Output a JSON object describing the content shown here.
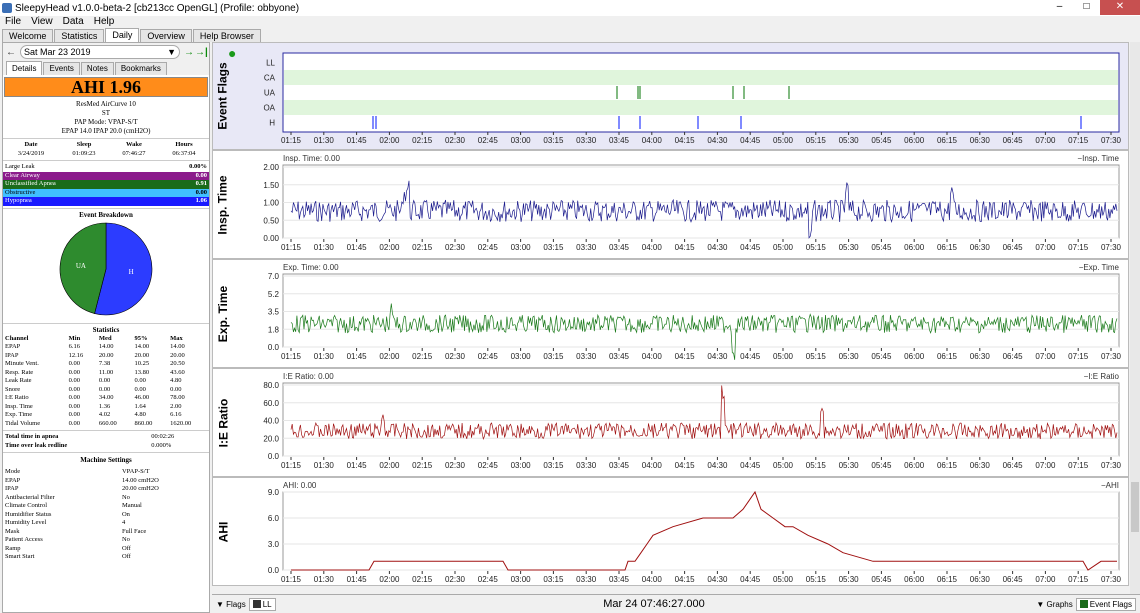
{
  "window": {
    "title": "SleepyHead v1.0.0-beta-2 [cb213cc OpenGL] (Profile: obbyone)"
  },
  "menu": [
    "File",
    "View",
    "Data",
    "Help"
  ],
  "tabs": [
    "Welcome",
    "Statistics",
    "Daily",
    "Overview",
    "Help Browser"
  ],
  "active_tab": "Daily",
  "nav": {
    "date": "Sat Mar 23 2019"
  },
  "subtabs": [
    "Details",
    "Events",
    "Notes",
    "Bookmarks"
  ],
  "summary": {
    "ahi": "AHI 1.96",
    "machine": "ResMed AirCurve 10",
    "model": "ST",
    "pap_mode": "PAP Mode: VPAP-S/T",
    "pressures": "EPAP 14.0 IPAP 20.0 (cmH2O)"
  },
  "session": {
    "headers": [
      "Date",
      "Sleep",
      "Wake",
      "Hours"
    ],
    "values": [
      "3/24/2019",
      "01:09:23",
      "07:46:27",
      "06:37:04"
    ]
  },
  "event_indices": [
    {
      "label": "Large Leak",
      "value": "0.00%",
      "color": "#ffffff"
    },
    {
      "label": "Clear Airway",
      "value": "0.00",
      "color": "#8b1a8b"
    },
    {
      "label": "Unclassified Apnea",
      "value": "0.91",
      "color": "#1a6b1a"
    },
    {
      "label": "Obstructive",
      "value": "0.00",
      "color": "#40c0ff"
    },
    {
      "label": "Hypopnea",
      "value": "1.06",
      "color": "#1a1aff"
    }
  ],
  "breakdown": {
    "title": "Event Breakdown",
    "slices": [
      {
        "label": "UA",
        "value": 46,
        "color": "#2e8b2e"
      },
      {
        "label": "H",
        "value": 54,
        "color": "#2c3cff"
      }
    ]
  },
  "statistics": {
    "title": "Statistics",
    "headers": [
      "Channel",
      "Min",
      "Med",
      "95%",
      "Max"
    ],
    "rows": [
      [
        "EPAP",
        "6.16",
        "14.00",
        "14.00",
        "14.00"
      ],
      [
        "IPAP",
        "12.16",
        "20.00",
        "20.00",
        "20.00"
      ],
      [
        "Minute Vent.",
        "0.00",
        "7.38",
        "10.25",
        "20.50"
      ],
      [
        "Resp. Rate",
        "0.00",
        "11.00",
        "13.80",
        "43.60"
      ],
      [
        "Leak Rate",
        "0.00",
        "0.00",
        "0.00",
        "4.80"
      ],
      [
        "Snore",
        "0.00",
        "0.00",
        "0.00",
        "0.00"
      ],
      [
        "I:E Ratio",
        "0.00",
        "34.00",
        "46.00",
        "78.00"
      ],
      [
        "Insp. Time",
        "0.00",
        "1.36",
        "1.64",
        "2.00"
      ],
      [
        "Exp. Time",
        "0.00",
        "4.02",
        "4.80",
        "6.16"
      ],
      [
        "Tidal Volume",
        "0.00",
        "660.00",
        "860.00",
        "1620.00"
      ]
    ]
  },
  "totals": [
    {
      "label": "Total time in apnea",
      "value": "00:02:26"
    },
    {
      "label": "Time over leak redline",
      "value": "0.000%"
    }
  ],
  "machine_settings": {
    "title": "Machine Settings",
    "rows": [
      [
        "Mode",
        "VPAP-S/T"
      ],
      [
        "EPAP",
        "14.00 cmH2O"
      ],
      [
        "IPAP",
        "20.00 cmH2O"
      ],
      [
        "Antibacterial Filter",
        "No"
      ],
      [
        "Climate Control",
        "Manual"
      ],
      [
        "Humidifier Status",
        "On"
      ],
      [
        "Humidity Level",
        "4"
      ],
      [
        "Mask",
        "Full Face"
      ],
      [
        "Patient Access",
        "No"
      ],
      [
        "Ramp",
        "Off"
      ],
      [
        "Smart Start",
        "Off"
      ]
    ]
  },
  "time_ticks": [
    "01:15",
    "01:30",
    "01:45",
    "02:00",
    "02:15",
    "02:30",
    "02:45",
    "03:00",
    "03:15",
    "03:30",
    "03:45",
    "04:00",
    "04:15",
    "04:30",
    "04:45",
    "05:00",
    "05:15",
    "05:30",
    "05:45",
    "06:00",
    "06:15",
    "06:30",
    "06:45",
    "07:00",
    "07:15",
    "07:30"
  ],
  "graphs": {
    "flags": {
      "title": "Event Flags",
      "rows": [
        "LL",
        "CA",
        "UA",
        "OA",
        "H"
      ]
    },
    "insp": {
      "title": "Insp. Time",
      "readout": "Insp. Time: 0.00",
      "legend": "Insp. Time",
      "yticks": [
        "2.00",
        "1.50",
        "1.00",
        "0.50",
        "0.00"
      ],
      "color": "#1a1a8c"
    },
    "exp": {
      "title": "Exp. Time",
      "readout": "Exp. Time: 0.00",
      "legend": "Exp. Time",
      "yticks": [
        "7.0",
        "5.2",
        "3.5",
        "1.8",
        "0.0"
      ],
      "color": "#1a7a1a"
    },
    "ie": {
      "title": "I:E Ratio",
      "readout": "I:E Ratio: 0.00",
      "legend": "I:E Ratio",
      "yticks": [
        "80.0",
        "60.0",
        "40.0",
        "20.0",
        "0.0"
      ],
      "color": "#a01010"
    },
    "ahi": {
      "title": "AHI",
      "readout": "AHI: 0.00",
      "legend": "AHI",
      "yticks": [
        "9.0",
        "6.0",
        "3.0",
        "0.0"
      ],
      "color": "#a01010"
    }
  },
  "bottom": {
    "flags_label": "Flags",
    "flags_combo": "LL",
    "center": "Mar 24 07:46:27.000",
    "graphs_label": "Graphs",
    "graphs_combo": "Event Flags"
  }
}
